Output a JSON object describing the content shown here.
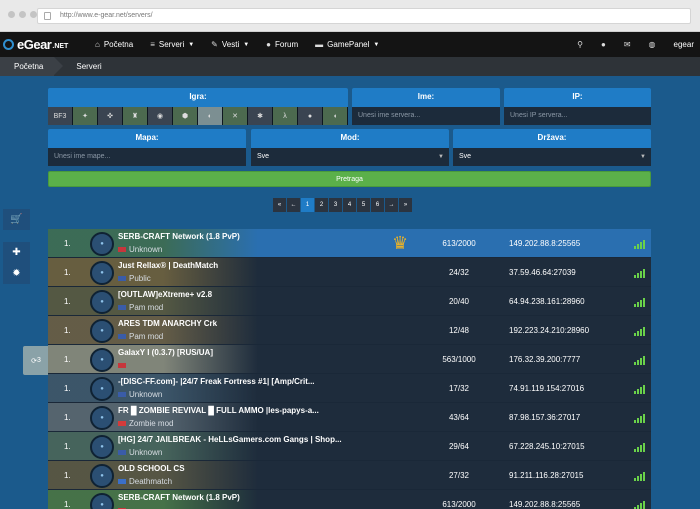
{
  "browser": {
    "url": "http://www.e-gear.net/servers/"
  },
  "nav": {
    "logo_word": "eGear",
    "logo_suffix": ".NET",
    "items": [
      {
        "label": "Početna",
        "icon": "home-icon",
        "dropdown": false
      },
      {
        "label": "Serveri",
        "icon": "database-icon",
        "dropdown": true
      },
      {
        "label": "Vesti",
        "icon": "pencil-icon",
        "dropdown": true
      },
      {
        "label": "Forum",
        "icon": "chat-icon",
        "dropdown": false
      },
      {
        "label": "GamePanel",
        "icon": "gamepad-icon",
        "dropdown": true
      }
    ],
    "user": "egear"
  },
  "breadcrumb": [
    "Početna",
    "Serveri"
  ],
  "filters": {
    "game_label": "Igra:",
    "name_label": "Ime:",
    "name_placeholder": "Unesi ime servera...",
    "ip_label": "IP:",
    "ip_placeholder": "Unesi IP servera...",
    "map_label": "Mapa:",
    "map_placeholder": "Unesi ime mape...",
    "mod_label": "Mod:",
    "mod_value": "Sve",
    "country_label": "Država:",
    "country_value": "Sve",
    "search_button": "Pretraga",
    "game_icons": [
      "BF3",
      "CS",
      "CSGO",
      "CoD2",
      "CS:S",
      "GTA",
      "MC",
      "TF2",
      "SAMP",
      "HL",
      "DOD",
      "TS"
    ]
  },
  "pagination": [
    "«",
    "←",
    "1",
    "2",
    "3",
    "4",
    "5",
    "6",
    "→",
    "»"
  ],
  "pagination_active": "1",
  "side_buttons": [
    "cart-icon",
    "plus-icon",
    "bug-icon"
  ],
  "hover_tag": "3",
  "servers": [
    {
      "rank": "1.",
      "name": "SERB-CRAFT Network (1.8 PvP)",
      "mod": "Unknown",
      "flag": "#c6363c",
      "players": "613/2000",
      "ip": "149.202.88.8:25565",
      "highlight": true,
      "crown": true
    },
    {
      "rank": "1.",
      "name": "Just Rellax® | DeathMatch",
      "mod": "Public",
      "flag": "#3a5ca8",
      "players": "24/32",
      "ip": "37.59.46.64:27039"
    },
    {
      "rank": "1.",
      "name": "[OUTLAW]eXtreme+ v2.8",
      "mod": "Pam mod",
      "flag": "#3a5ca8",
      "players": "20/40",
      "ip": "64.94.238.161:28960"
    },
    {
      "rank": "1.",
      "name": "ARES TDM ANARCHY Crk",
      "mod": "Pam mod",
      "flag": "#3a5ca8",
      "players": "12/48",
      "ip": "192.223.24.210:28960"
    },
    {
      "rank": "1.",
      "name": "GalaxY I (0.3.7) [RUS/UA]",
      "mod": "",
      "flag": "#c6363c",
      "players": "563/1000",
      "ip": "176.32.39.200:7777"
    },
    {
      "rank": "1.",
      "name": "-[DISC-FF.com]- |24/7 Freak Fortress #1| [Amp/Crit...",
      "mod": "Unknown",
      "flag": "#3a5ca8",
      "players": "17/32",
      "ip": "74.91.119.154:27016"
    },
    {
      "rank": "1.",
      "name": "FR █ ZOMBIE REVIVAL █ FULL AMMO |les-papys-a...",
      "mod": "Zombie mod",
      "flag": "#d33b3b",
      "players": "43/64",
      "ip": "87.98.157.36:27017"
    },
    {
      "rank": "1.",
      "name": "[HG] 24/7 JAILBREAK - HeLLsGamers.com Gangs | Shop...",
      "mod": "Unknown",
      "flag": "#3a5ca8",
      "players": "29/64",
      "ip": "67.228.245.10:27015"
    },
    {
      "rank": "1.",
      "name": "OLD SCHOOL CS",
      "mod": "Deathmatch",
      "flag": "#3b6fc7",
      "players": "27/32",
      "ip": "91.211.116.28:27015"
    },
    {
      "rank": "1.",
      "name": "SERB-CRAFT Network (1.8 PvP)",
      "mod": "",
      "flag": "#c6363c",
      "players": "613/2000",
      "ip": "149.202.88.8:25565"
    }
  ]
}
